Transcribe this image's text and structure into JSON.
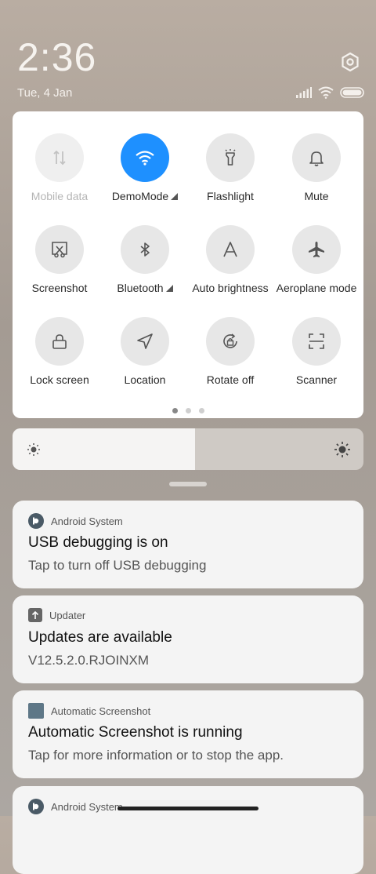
{
  "status": {
    "time": "2:36",
    "date": "Tue, 4 Jan"
  },
  "quick_settings": {
    "tiles": [
      {
        "label": "Mobile data",
        "icon": "mobile-data-icon",
        "state": "disabled"
      },
      {
        "label": "DemoMode",
        "icon": "wifi-icon",
        "state": "active"
      },
      {
        "label": "Flashlight",
        "icon": "flashlight-icon",
        "state": "off"
      },
      {
        "label": "Mute",
        "icon": "bell-icon",
        "state": "off"
      },
      {
        "label": "Screenshot",
        "icon": "screenshot-icon",
        "state": "off"
      },
      {
        "label": "Bluetooth",
        "icon": "bluetooth-icon",
        "state": "off"
      },
      {
        "label": "Auto brightness",
        "icon": "auto-brightness-icon",
        "state": "off"
      },
      {
        "label": "Aeroplane mode",
        "icon": "airplane-icon",
        "state": "off"
      },
      {
        "label": "Lock screen",
        "icon": "lock-icon",
        "state": "off"
      },
      {
        "label": "Location",
        "icon": "location-icon",
        "state": "off"
      },
      {
        "label": "Rotate off",
        "icon": "rotate-lock-icon",
        "state": "off"
      },
      {
        "label": "Scanner",
        "icon": "scanner-icon",
        "state": "off"
      }
    ],
    "active_color": "#1e90ff",
    "page_index": 1,
    "page_count": 3
  },
  "brightness": {
    "level": 0.52
  },
  "notifications": [
    {
      "app": "Android System",
      "title": "USB debugging is on",
      "body": "Tap to turn off USB debugging"
    },
    {
      "app": "Updater",
      "title": "Updates are available",
      "body": "V12.5.2.0.RJOINXM"
    },
    {
      "app": "Automatic Screenshot",
      "title": "Automatic Screenshot is running",
      "body": "Tap for more information or to stop the app."
    },
    {
      "app": "Android System"
    }
  ]
}
